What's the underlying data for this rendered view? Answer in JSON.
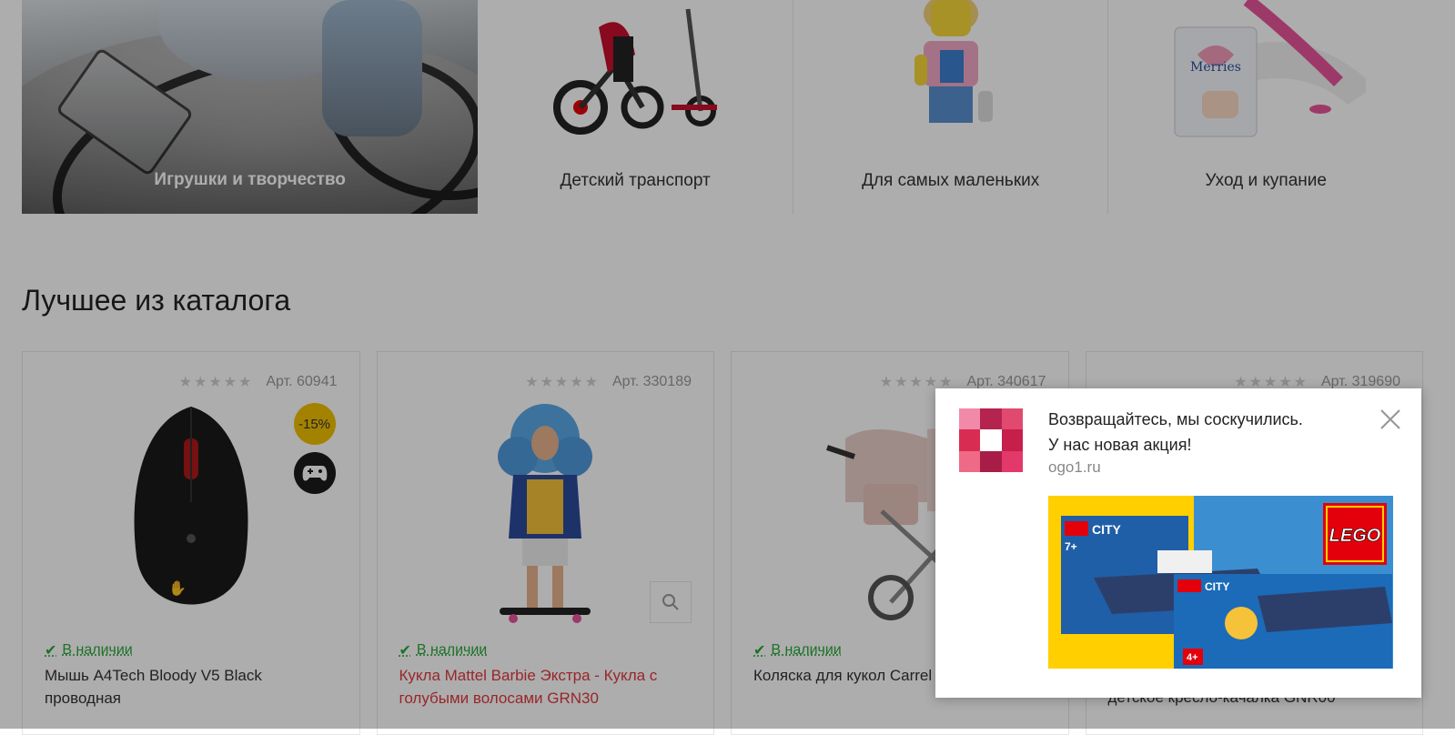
{
  "categories": {
    "hero_label": "Игрушки и творчество",
    "items": [
      {
        "label": "Детский транспорт"
      },
      {
        "label": "Для самых маленьких"
      },
      {
        "label": "Уход и купание"
      }
    ]
  },
  "section_title": "Лучшее из каталога",
  "products": [
    {
      "art": "Арт. 60941",
      "stock": "В наличии",
      "name": "Мышь A4Tech Bloody V5 Black проводная",
      "badge": "-15%",
      "stars": "★★★★★"
    },
    {
      "art": "Арт. 330189",
      "stock": "В наличии",
      "name": "Кукла Mattel Barbie Экстра - Кукла с голубыми волосами GRN30",
      "stars": "★★★★★"
    },
    {
      "art": "Арт. 340617",
      "stock": "В наличии",
      "name": "Коляска для кукол Carrel",
      "stars": "★★★★★"
    },
    {
      "art": "Арт. 319690",
      "stock": "",
      "name": "детское кресло-качалка GNR00",
      "stars": "★★★★★"
    }
  ],
  "popup": {
    "title": "Возвращайтесь, мы соскучились.",
    "subtitle": "У нас новая акция!",
    "domain": "ogo1.ru",
    "banner": {
      "brand": "LEGO",
      "series": "CITY",
      "age": "4+",
      "age2": "7+"
    }
  },
  "colors": {
    "accent_red": "#e0393e",
    "stock_green": "#2aa83a",
    "sale_badge": "#f0c000",
    "lego_red": "#e3000b",
    "lego_yellow": "#ffcf00"
  }
}
